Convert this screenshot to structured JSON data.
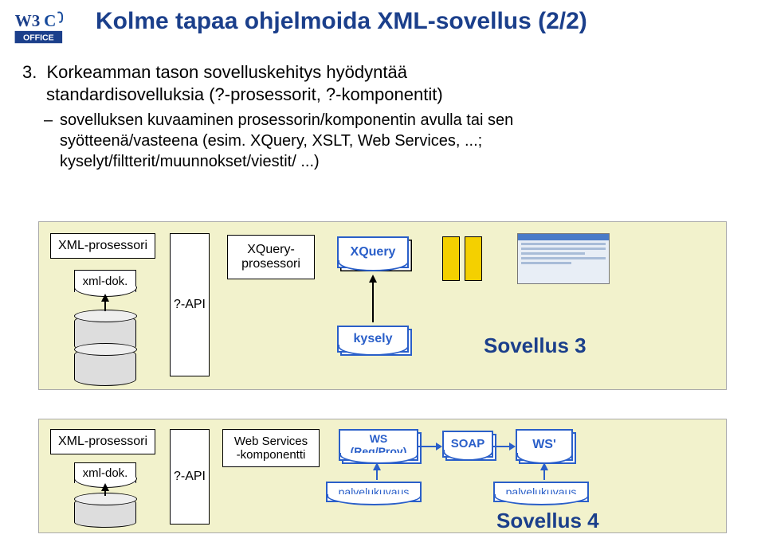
{
  "title": "Kolme tapaa ohjelmoida XML-sovellus (2/2)",
  "section": {
    "number": "3.",
    "line1": "Korkeamman tason sovelluskehitys hyödyntää",
    "line2": "standardisovelluksia (?-prosessorit, ?-komponentit)",
    "sub1": "sovelluksen kuvaaminen prosessorin/komponentin avulla tai sen",
    "sub2": "syötteenä/vasteena (esim. XQuery, XSLT, Web Services, ...;",
    "sub3": "kyselyt/filtterit/muunnokset/viestit/ ...)"
  },
  "panel1": {
    "xml_processor": "XML-prosessori",
    "xml_dok": "xml-dok.",
    "api": "?-API",
    "xquery_proc": "XQuery-\nprosessori",
    "xquery": "XQuery",
    "kysely": "kysely",
    "app_label": "Sovellus 3"
  },
  "panel2": {
    "xml_processor": "XML-prosessori",
    "xml_dok": "xml-dok.",
    "api": "?-API",
    "ws_comp": "Web Services\n-komponentti",
    "ws": "WS\n(Req/Prov)",
    "soap": "SOAP",
    "ws_prime": "WS'",
    "palvelu1": "palvelukuvaus",
    "palvelu2": "palvelukuvaus",
    "app_label": "Sovellus 4"
  }
}
